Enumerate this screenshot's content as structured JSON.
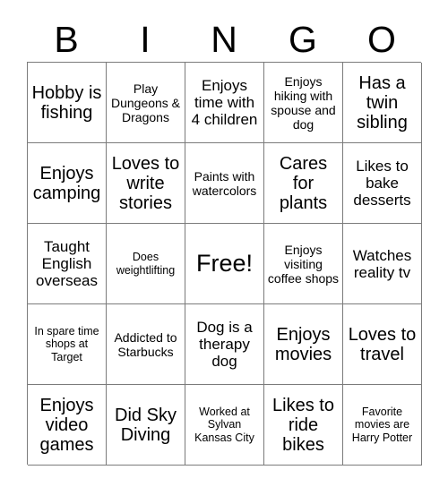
{
  "card": {
    "title": "BINGO Card",
    "header_letters": [
      "B",
      "I",
      "N",
      "G",
      "O"
    ],
    "free_space": {
      "row": 2,
      "col": 2,
      "label": "Free!"
    },
    "grid": {
      "rows": 5,
      "cols": 5,
      "cells": [
        [
          {
            "text": "Hobby is fishing",
            "size": "lg"
          },
          {
            "text": "Play Dungeons & Dragons",
            "size": "sm"
          },
          {
            "text": "Enjoys time with 4 children",
            "size": "md"
          },
          {
            "text": "Enjoys hiking with spouse and dog",
            "size": "sm"
          },
          {
            "text": "Has a twin sibling",
            "size": "lg"
          }
        ],
        [
          {
            "text": "Enjoys camping",
            "size": "lg"
          },
          {
            "text": "Loves to write stories",
            "size": "lg"
          },
          {
            "text": "Paints with watercolors",
            "size": "sm"
          },
          {
            "text": "Cares for plants",
            "size": "lg"
          },
          {
            "text": "Likes to bake desserts",
            "size": "md"
          }
        ],
        [
          {
            "text": "Taught English overseas",
            "size": "md"
          },
          {
            "text": "Does weightlifting",
            "size": "xs"
          },
          {
            "text": "Free!",
            "size": "xl"
          },
          {
            "text": "Enjoys visiting coffee shops",
            "size": "sm"
          },
          {
            "text": "Watches reality tv",
            "size": "md"
          }
        ],
        [
          {
            "text": "In spare time shops at Target",
            "size": "xs"
          },
          {
            "text": "Addicted to Starbucks",
            "size": "sm"
          },
          {
            "text": "Dog is a therapy dog",
            "size": "md"
          },
          {
            "text": "Enjoys movies",
            "size": "lg"
          },
          {
            "text": "Loves to travel",
            "size": "lg"
          }
        ],
        [
          {
            "text": "Enjoys video games",
            "size": "lg"
          },
          {
            "text": "Did Sky Diving",
            "size": "lg"
          },
          {
            "text": "Worked at Sylvan Kansas City",
            "size": "xs"
          },
          {
            "text": "Likes to ride bikes",
            "size": "lg"
          },
          {
            "text": "Favorite movies are Harry Potter",
            "size": "xs"
          }
        ]
      ]
    }
  },
  "colors": {
    "background": "#ffffff",
    "text": "#000000",
    "grid_line": "#7b7b7b"
  }
}
